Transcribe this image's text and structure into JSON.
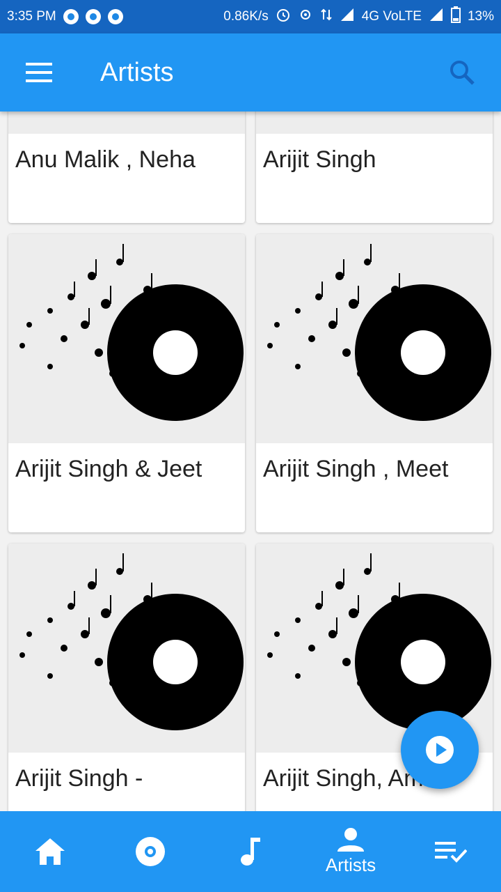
{
  "status_bar": {
    "time": "3:35 PM",
    "speed": "0.86K/s",
    "network": "4G VoLTE",
    "battery": "13%"
  },
  "app_bar": {
    "title": "Artists"
  },
  "artists": [
    {
      "name": "Anu Malik , Neha"
    },
    {
      "name": "Arijit Singh"
    },
    {
      "name": "Arijit Singh & Jeet"
    },
    {
      "name": "Arijit Singh , Meet"
    },
    {
      "name": "Arijit Singh -"
    },
    {
      "name": "Arijit Singh, Amit"
    }
  ],
  "bottom_nav": {
    "items": [
      {
        "icon": "home-icon",
        "label": ""
      },
      {
        "icon": "album-icon",
        "label": ""
      },
      {
        "icon": "music-note-icon",
        "label": ""
      },
      {
        "icon": "person-icon",
        "label": "Artists"
      },
      {
        "icon": "playlist-icon",
        "label": ""
      }
    ]
  },
  "colors": {
    "primary": "#2196f3",
    "status_bar": "#1565c0"
  }
}
